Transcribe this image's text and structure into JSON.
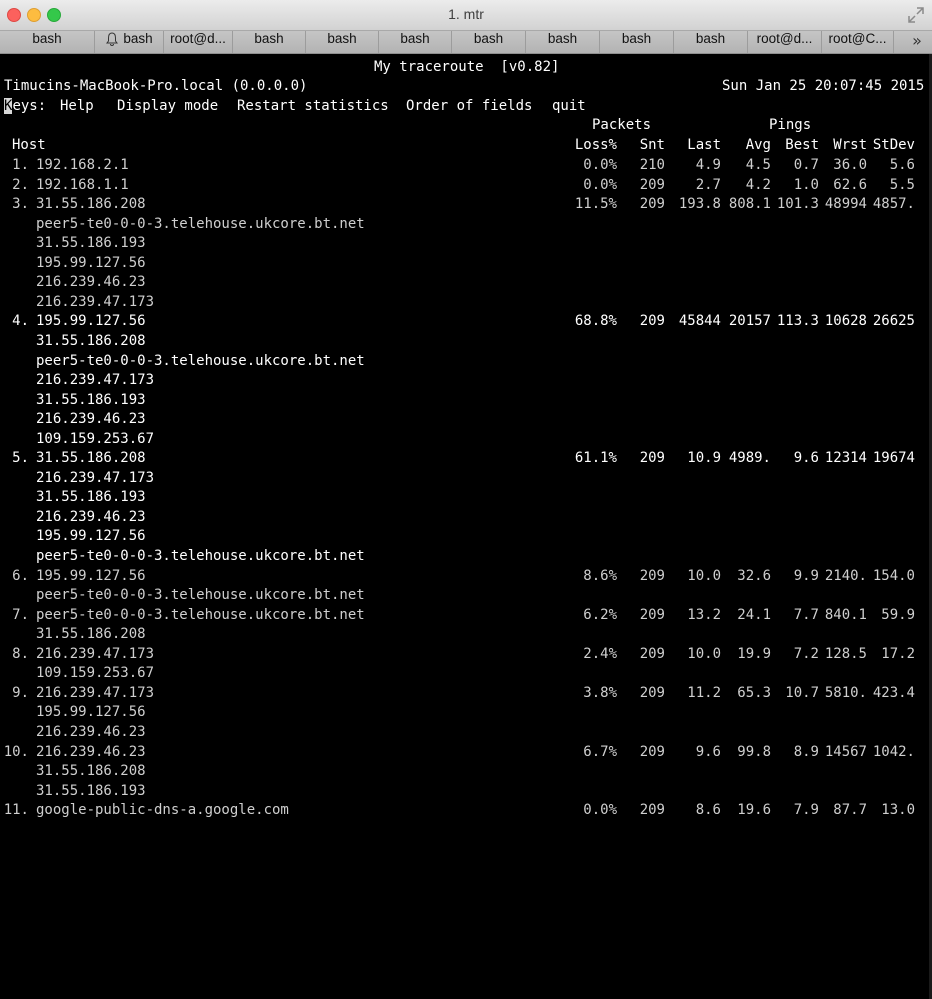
{
  "window": {
    "title": "1. mtr"
  },
  "tabs": [
    {
      "label": "bash",
      "bell": false
    },
    {
      "label": "bash",
      "bell": true
    },
    {
      "label": "root@d...",
      "bell": false
    },
    {
      "label": "bash",
      "bell": false
    },
    {
      "label": "bash",
      "bell": false
    },
    {
      "label": "bash",
      "bell": false
    },
    {
      "label": "bash",
      "bell": false
    },
    {
      "label": "bash",
      "bell": false
    },
    {
      "label": "bash",
      "bell": false
    },
    {
      "label": "bash",
      "bell": false
    },
    {
      "label": "root@d...",
      "bell": false
    },
    {
      "label": "root@C...",
      "bell": false
    }
  ],
  "tab_overflow": "»",
  "mtr": {
    "title": "My traceroute  [v0.82]",
    "hostname": "Timucins-MacBook-Pro.local (0.0.0.0)",
    "datetime": "Sun Jan 25 20:07:45 2015",
    "keys_label": "Keys:",
    "keys_first": "K",
    "keys_rest": "eys:",
    "keys": [
      "Help",
      "Display mode",
      "Restart statistics",
      "Order of fields",
      "quit"
    ],
    "group_packets": "Packets",
    "group_pings": "Pings",
    "col_host": "Host",
    "columns": [
      "Loss%",
      "Snt",
      "Last",
      "Avg",
      "Best",
      "Wrst",
      "StDev"
    ],
    "rows": [
      {
        "n": "1.",
        "host": "192.168.2.1",
        "stats": [
          "0.0%",
          "210",
          "4.9",
          "4.5",
          "0.7",
          "36.0",
          "5.6"
        ],
        "alts": [],
        "bright": false
      },
      {
        "n": "2.",
        "host": "192.168.1.1",
        "stats": [
          "0.0%",
          "209",
          "2.7",
          "4.2",
          "1.0",
          "62.6",
          "5.5"
        ],
        "alts": [],
        "bright": false
      },
      {
        "n": "3.",
        "host": "31.55.186.208",
        "stats": [
          "11.5%",
          "209",
          "193.8",
          "808.1",
          "101.3",
          "48994",
          "4857."
        ],
        "alts": [
          "peer5-te0-0-0-3.telehouse.ukcore.bt.net",
          "31.55.186.193",
          "195.99.127.56",
          "216.239.46.23",
          "216.239.47.173"
        ],
        "bright": false
      },
      {
        "n": "4.",
        "host": "195.99.127.56",
        "stats": [
          "68.8%",
          "209",
          "45844",
          "20157",
          "113.3",
          "10628",
          "26625"
        ],
        "alts": [
          "31.55.186.208",
          "peer5-te0-0-0-3.telehouse.ukcore.bt.net",
          "216.239.47.173",
          "31.55.186.193",
          "216.239.46.23",
          "109.159.253.67"
        ],
        "bright": true
      },
      {
        "n": "5.",
        "host": "31.55.186.208",
        "stats": [
          "61.1%",
          "209",
          "10.9",
          "4989.",
          "9.6",
          "12314",
          "19674"
        ],
        "alts": [
          "216.239.47.173",
          "31.55.186.193",
          "216.239.46.23",
          "195.99.127.56",
          "peer5-te0-0-0-3.telehouse.ukcore.bt.net"
        ],
        "bright": true
      },
      {
        "n": "6.",
        "host": "195.99.127.56",
        "stats": [
          "8.6%",
          "209",
          "10.0",
          "32.6",
          "9.9",
          "2140.",
          "154.0"
        ],
        "alts": [
          "peer5-te0-0-0-3.telehouse.ukcore.bt.net"
        ],
        "bright": false
      },
      {
        "n": "7.",
        "host": "peer5-te0-0-0-3.telehouse.ukcore.bt.net",
        "stats": [
          "6.2%",
          "209",
          "13.2",
          "24.1",
          "7.7",
          "840.1",
          "59.9"
        ],
        "alts": [
          "31.55.186.208"
        ],
        "bright": false
      },
      {
        "n": "8.",
        "host": "216.239.47.173",
        "stats": [
          "2.4%",
          "209",
          "10.0",
          "19.9",
          "7.2",
          "128.5",
          "17.2"
        ],
        "alts": [
          "109.159.253.67"
        ],
        "bright": false
      },
      {
        "n": "9.",
        "host": "216.239.47.173",
        "stats": [
          "3.8%",
          "209",
          "11.2",
          "65.3",
          "10.7",
          "5810.",
          "423.4"
        ],
        "alts": [
          "195.99.127.56",
          "216.239.46.23"
        ],
        "bright": false
      },
      {
        "n": "10.",
        "host": "216.239.46.23",
        "stats": [
          "6.7%",
          "209",
          "9.6",
          "99.8",
          "8.9",
          "14567",
          "1042."
        ],
        "alts": [
          "31.55.186.208",
          "31.55.186.193"
        ],
        "bright": false
      },
      {
        "n": "11.",
        "host": "google-public-dns-a.google.com",
        "stats": [
          "0.0%",
          "209",
          "8.6",
          "19.6",
          "7.9",
          "87.7",
          "13.0"
        ],
        "alts": [],
        "bright": false
      }
    ]
  }
}
